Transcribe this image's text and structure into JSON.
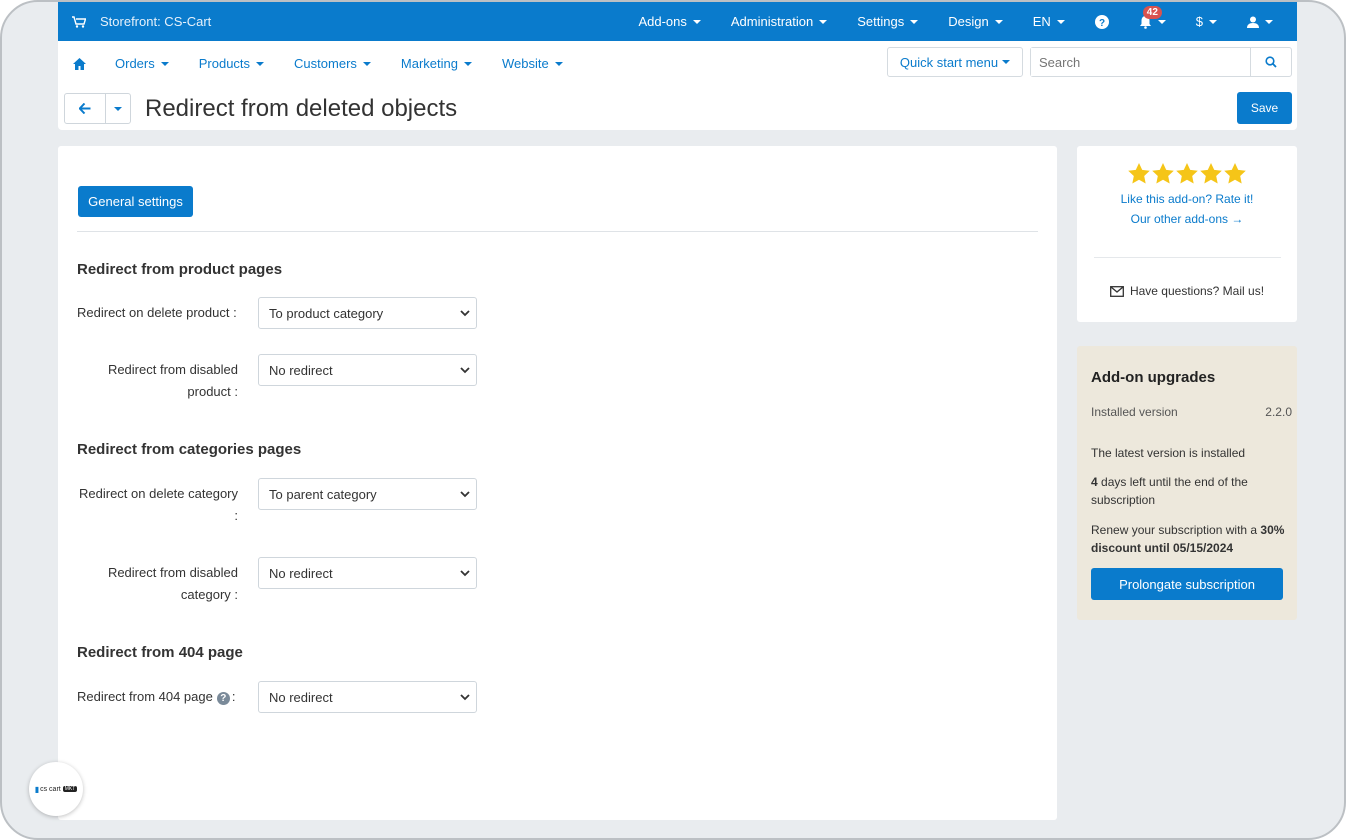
{
  "topbar": {
    "storefront": "Storefront: CS-Cart",
    "menu": [
      "Add-ons",
      "Administration",
      "Settings",
      "Design",
      "EN"
    ],
    "notifications_count": "42",
    "currency": "$"
  },
  "navbar": {
    "items": [
      "Orders",
      "Products",
      "Customers",
      "Marketing",
      "Website"
    ],
    "quick_start": "Quick start menu",
    "search_placeholder": "Search"
  },
  "page": {
    "title": "Redirect from deleted objects",
    "save_label": "Save"
  },
  "main": {
    "tab": "General settings",
    "sections": {
      "product": {
        "heading": "Redirect from product pages",
        "delete_label": "Redirect on delete product :",
        "delete_value": "To product category",
        "disabled_label_1": "Redirect from disabled",
        "disabled_label_2": "product :",
        "disabled_value": "No redirect"
      },
      "category": {
        "heading": "Redirect from categories pages",
        "delete_label_1": "Redirect on delete category",
        "delete_label_2": ":",
        "delete_value": "To parent category",
        "disabled_label_1": "Redirect from disabled",
        "disabled_label_2": "category :",
        "disabled_value": "No redirect"
      },
      "p404": {
        "heading": "Redirect from 404 page",
        "label": "Redirect from 404 page",
        "label_suffix": ":",
        "value": "No redirect"
      }
    }
  },
  "sidebar": {
    "rating": {
      "stars": 5,
      "rate_link": "Like this add-on? Rate it!",
      "other_link": "Our other add-ons →",
      "mail": "Have questions? Mail us!"
    },
    "upgrades": {
      "heading": "Add-on upgrades",
      "installed_label": "Installed version",
      "installed_value": "2.2.0",
      "latest": "The latest version is installed",
      "days": "4",
      "days_text": " days left until the end of the subscription",
      "renew_text": "Renew your subscription with a ",
      "renew_bold": "30% discount until 05/15/2024",
      "button": "Prolongate subscription"
    }
  },
  "logo": {
    "text": "cs cart",
    "pill": "MKT"
  },
  "colors": {
    "accent": "#0a7bcc",
    "star": "#f5c518",
    "upgrades_bg": "#ede8dc"
  }
}
